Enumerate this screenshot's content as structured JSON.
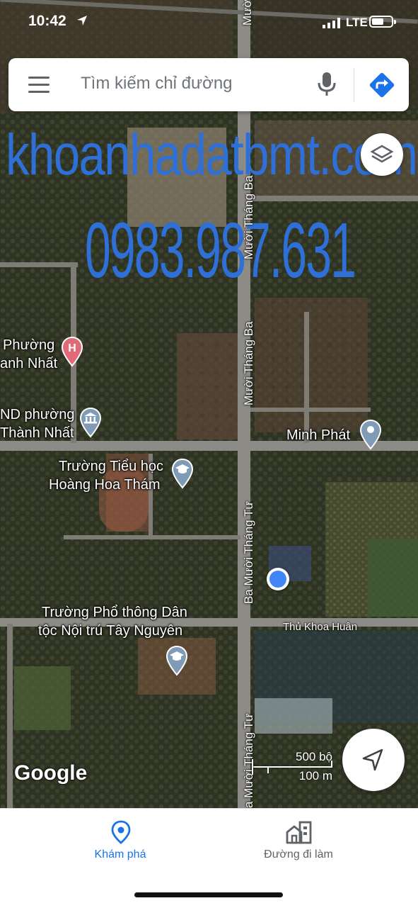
{
  "status_bar": {
    "time": "10:42",
    "network": "LTE"
  },
  "search": {
    "placeholder": "Tìm kiếm chỉ đường"
  },
  "watermark": {
    "site": "khoanhadatbmt.com",
    "phone": "0983.987.631"
  },
  "map": {
    "places": {
      "hospital_line1": "Phường",
      "hospital_line2": "anh Nhất",
      "committee_line1": "ND phường",
      "committee_line2": "Thành Nhất",
      "minh_phat": "Minh Phát",
      "school1_line1": "Trường Tiểu học",
      "school1_line2": "Hoàng Hoa Thám",
      "school2_line1": "Trường Phổ thông Dân",
      "school2_line2": "tộc Nội trú Tây Nguyên"
    },
    "roads": {
      "top": "Mười",
      "muoi_thang_ba_1": "Mười Tháng Ba",
      "muoi_thang_ba_2": "Mười Tháng Ba",
      "ba_muoi_thang_tu_1": "Ba Mười Tháng Tư",
      "ba_muoi_thang_tu_2": "a Mười Tháng Tư",
      "thu_khoa_huan": "Thủ Khoa Huân"
    },
    "attribution": "Google",
    "scale": {
      "imperial": "500 bộ",
      "metric": "100 m"
    }
  },
  "bottom_nav": {
    "tabs": [
      {
        "label": "Khám phá",
        "active": true,
        "icon": "location-pin-icon"
      },
      {
        "label": "Đường đi làm",
        "active": false,
        "icon": "commute-icon"
      }
    ]
  },
  "colors": {
    "accent": "#1a73e8",
    "watermark": "#2f6fd8",
    "location_dot": "#4285f4"
  }
}
